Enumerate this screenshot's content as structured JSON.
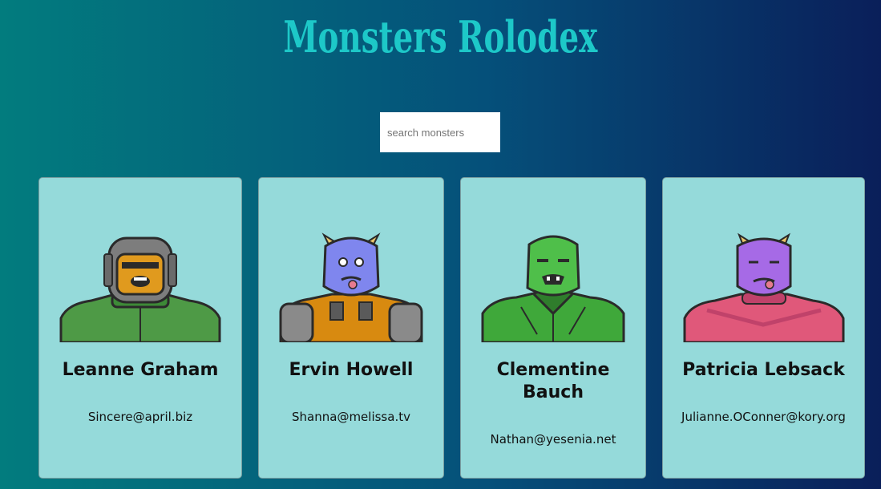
{
  "app": {
    "title": "Monsters Rolodex"
  },
  "search": {
    "placeholder": "search monsters",
    "value": ""
  },
  "monsters": [
    {
      "name": "Leanne Graham",
      "email": "Sincere@april.biz",
      "skin": "#e09a1e",
      "shirt": "#5cb24a",
      "accent": "#7d7d7d"
    },
    {
      "name": "Ervin Howell",
      "email": "Shanna@melissa.tv",
      "skin": "#7f86ee",
      "shirt": "#d88a10",
      "accent": "#8a8a8a"
    },
    {
      "name": "Clementine Bauch",
      "email": "Nathan@yesenia.net",
      "skin": "#4fbf4a",
      "shirt": "#3fa83a",
      "accent": "#2f7d2c"
    },
    {
      "name": "Patricia Lebsack",
      "email": "Julianne.OConner@kory.org",
      "skin": "#a66ae6",
      "shirt": "#e0587a",
      "accent": "#c0426a"
    }
  ]
}
